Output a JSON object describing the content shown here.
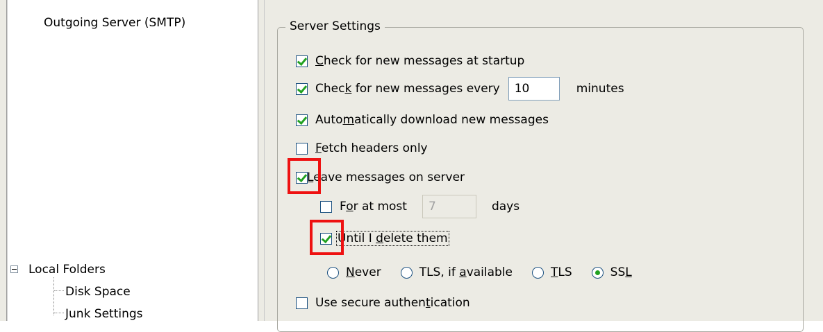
{
  "tree": {
    "outgoing_server": "Outgoing Server (SMTP)",
    "local_folders": "Local Folders",
    "disk_space": "Disk Space",
    "junk_settings": "Junk Settings"
  },
  "server_settings": {
    "group_title": "Server Settings",
    "check_startup": {
      "label_pre": "",
      "label_key": "C",
      "label_post": "heck for new messages at startup",
      "checked": true
    },
    "check_every": {
      "label_pre": "Chec",
      "label_key": "k",
      "label_post": " for new messages every",
      "checked": true,
      "value": "10",
      "unit": "minutes"
    },
    "auto_download": {
      "label_pre": "Auto",
      "label_key": "m",
      "label_post": "atically download new messages",
      "checked": true
    },
    "fetch_headers": {
      "label_pre": "",
      "label_key": "F",
      "label_post": "etch headers only",
      "checked": false
    },
    "leave_on_server": {
      "label_pre": "",
      "label_key": "L",
      "label_post": "eave messages on server",
      "checked": true
    },
    "for_at_most": {
      "label_pre": "F",
      "label_key": "o",
      "label_post": "r at most",
      "checked": false,
      "value": "7",
      "unit": "days"
    },
    "until_delete": {
      "label_pre": "Until I ",
      "label_key": "d",
      "label_post": "elete them",
      "checked": true
    },
    "security": {
      "never": {
        "label_pre": "",
        "label_key": "N",
        "label_post": "ever",
        "selected": false
      },
      "tls_if_available": {
        "label_pre": "TLS, if ",
        "label_key": "a",
        "label_post": "vailable",
        "selected": false
      },
      "tls": {
        "label_pre": "",
        "label_key": "T",
        "label_post": "LS",
        "selected": false
      },
      "ssl": {
        "label_pre": "SS",
        "label_key": "L",
        "label_post": "",
        "selected": true
      }
    },
    "secure_auth": {
      "label_pre": "Use secure authen",
      "label_key": "t",
      "label_post": "ication",
      "checked": false
    }
  },
  "colors": {
    "highlight": "#ee1111",
    "check": "#21a121",
    "panel": "#ecebe4"
  }
}
